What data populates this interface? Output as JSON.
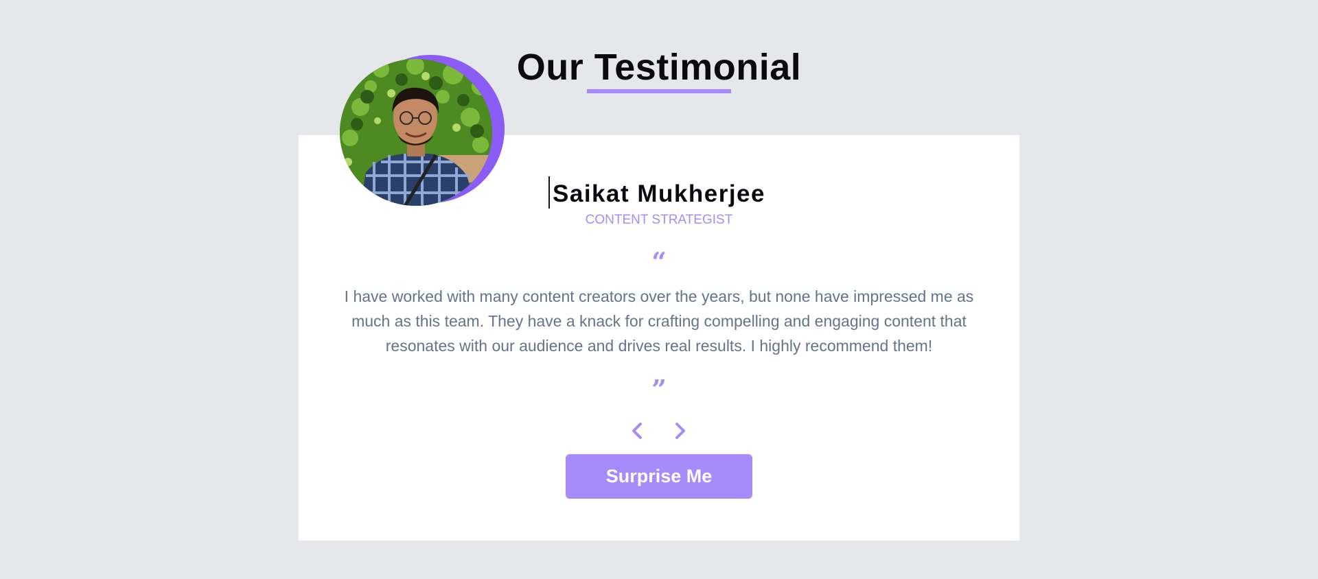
{
  "section": {
    "title": "Our Testimonial",
    "accent_color": "#a78bfa",
    "ring_color": "#8b5cf6"
  },
  "testimonial": {
    "name": "Saikat Mukherjee",
    "role": "Content Strategist",
    "open_quote": "“",
    "close_quote": "”",
    "text": "I have worked with many content creators over the years, but none have impressed me as much as this team. They have a knack for crafting compelling and engaging content that resonates with our audience and drives real results. I highly recommend them!",
    "avatar_icon": "person-photo"
  },
  "controls": {
    "prev_icon": "chevron-left-icon",
    "next_icon": "chevron-right-icon",
    "surprise_label": "Surprise Me"
  }
}
